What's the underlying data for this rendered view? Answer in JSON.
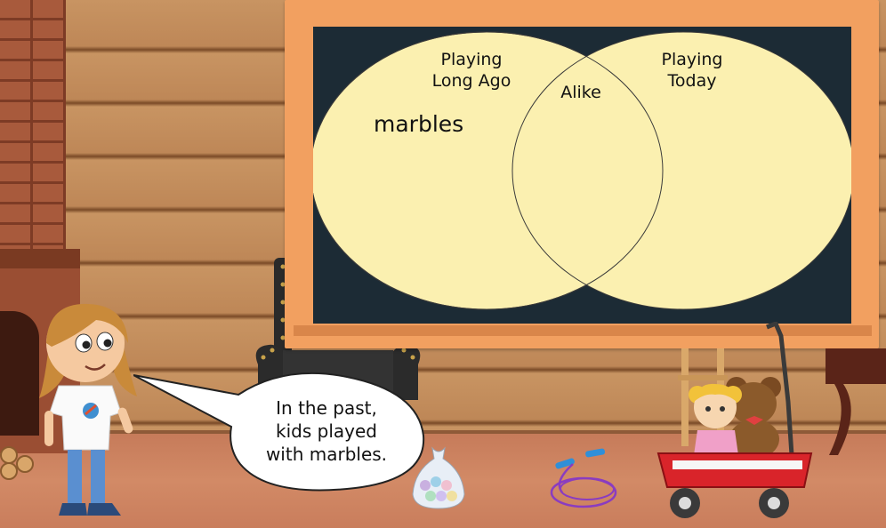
{
  "venn": {
    "left_title": "Playing\nLong Ago",
    "right_title": "Playing\nToday",
    "overlap_title": "Alike",
    "left_items": [
      "marbles"
    ]
  },
  "speech_bubble": {
    "text": "In the past,\nkids played\nwith marbles."
  },
  "colors": {
    "board_frame": "#f2a060",
    "board_surface": "#1c2b35",
    "venn_fill": "#fbf0b0",
    "wall": "#c89462",
    "floor": "#d28a66"
  },
  "icons": [
    "girl-character",
    "marbles-bag-icon",
    "jump-rope-icon",
    "doll-icon",
    "teddy-bear-icon",
    "wagon-icon",
    "armchair-icon"
  ]
}
